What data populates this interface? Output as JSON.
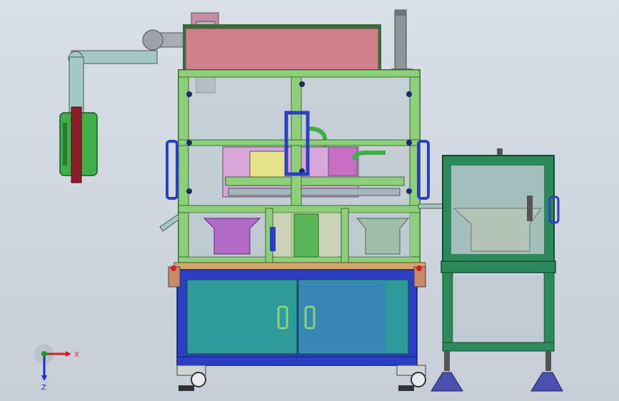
{
  "viewport": {
    "background_top": "#d9dfe6",
    "background_bottom": "#c7ced8"
  },
  "triad": {
    "x_label": "X",
    "z_label": "Z",
    "x_color": "#d42020",
    "z_color": "#1a2bd0",
    "y_color": "#10a010"
  },
  "colors": {
    "frame_green": "#8ed07a",
    "frame_dark": "#3a6d34",
    "cabinet_blue": "#2a3fc4",
    "cabinet_teal": "#2e9a9a",
    "pink_panel": "#cf7e8a",
    "grey_arm": "#a9acb3",
    "bowl_purple": "#b46bc8",
    "green_box": "#3fae46",
    "stand_green": "#2c8a5a",
    "foot_blue": "#4a4fb0"
  }
}
